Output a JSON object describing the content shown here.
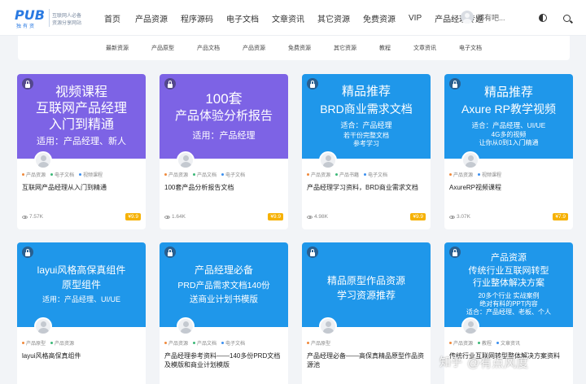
{
  "logo": {
    "mark": "PUB",
    "sub": "独有资",
    "tag1": "互联网人必备",
    "tag2": "资源分享网站"
  },
  "nav": [
    "首页",
    "产品资源",
    "程序源码",
    "电子文档",
    "文章资讯",
    "其它资源",
    "免费资源",
    "VIP",
    "产品经理专题"
  ],
  "user": {
    "name": "都有吧..."
  },
  "categories": [
    "最新资源",
    "产品原型",
    "产品文档",
    "产品资源",
    "免费资源",
    "其它资源",
    "教程",
    "文章资讯",
    "电子文档"
  ],
  "colors": {
    "purple": "#7d63e5",
    "blue": "#1f97ea",
    "price_bg": "#f6b100"
  },
  "cards": [
    {
      "thumb_lines": [
        "视频课程",
        "互联网产品经理",
        "入门到精通",
        "适用：产品经理、新人"
      ],
      "tags": [
        {
          "text": "产品资源",
          "color": "#f08a3c"
        },
        {
          "text": "电子文档",
          "color": "#3cb878"
        },
        {
          "text": "视频课程",
          "color": "#3b8ff0"
        }
      ],
      "title": "互联网产品经理从入门到精通",
      "views": "7.57K",
      "price": "¥9.9"
    },
    {
      "thumb_lines": [
        "100套",
        "产品体验分析报告",
        "适用：产品经理"
      ],
      "tags": [
        {
          "text": "产品资源",
          "color": "#f08a3c"
        },
        {
          "text": "产品文档",
          "color": "#3cb878"
        },
        {
          "text": "电子文档",
          "color": "#3b8ff0"
        }
      ],
      "title": "100套产品分析报告文档",
      "views": "1.64K",
      "price": "¥9.9"
    },
    {
      "thumb_lines": [
        "精品推荐",
        "BRD商业需求文档",
        "适合：产品经理",
        "若干份完整文档",
        "参考学习"
      ],
      "tags": [
        {
          "text": "产品资源",
          "color": "#f08a3c"
        },
        {
          "text": "产品书籍",
          "color": "#3cb878"
        },
        {
          "text": "电子文档",
          "color": "#3b8ff0"
        }
      ],
      "title": "产品经理学习资料，BRD商业需求文档",
      "views": "4.98K",
      "price": "¥9.9"
    },
    {
      "thumb_lines": [
        "精品推荐",
        "Axure RP教学视频",
        "适合：产品经理、UI/UE",
        "4G多的视频",
        "让你从0到1入门精通"
      ],
      "tags": [
        {
          "text": "产品资源",
          "color": "#f08a3c"
        },
        {
          "text": "视频课程",
          "color": "#3b8ff0"
        }
      ],
      "title": "AxureRP视频课程",
      "views": "3.07K",
      "price": "¥7.9"
    },
    {
      "thumb_lines": [
        "layui风格高保真组件",
        "原型组件",
        "适用：产品经理、UI/UE"
      ],
      "tags": [
        {
          "text": "产品原型",
          "color": "#f08a3c"
        },
        {
          "text": "产品资源",
          "color": "#3cb878"
        }
      ],
      "title": "layui风格高保真组件",
      "views": "",
      "price": ""
    },
    {
      "thumb_lines": [
        "产品经理必备",
        "PRD产品需求文档140份",
        "送商业计划书模版"
      ],
      "tags": [
        {
          "text": "产品资源",
          "color": "#f08a3c"
        },
        {
          "text": "产品文档",
          "color": "#3cb878"
        },
        {
          "text": "电子文档",
          "color": "#3b8ff0"
        }
      ],
      "title": "产品经理参考资料——140多份PRD文档及模版和商业计划模版",
      "views": "",
      "price": ""
    },
    {
      "thumb_lines": [
        "精品原型作品资源",
        "学习资源推荐"
      ],
      "tags": [
        {
          "text": "产品原型",
          "color": "#f08a3c"
        }
      ],
      "title": "产品经理必备——高保真精品原型作品资源池",
      "views": "",
      "price": ""
    },
    {
      "thumb_lines": [
        "产品资源",
        "传统行业互联网转型",
        "行业整体解决方案",
        "20多个行业   实战案例",
        "绝对有料的PPT内容",
        "适合：产品经理、老板、个人"
      ],
      "tags": [
        {
          "text": "产品资源",
          "color": "#f08a3c"
        },
        {
          "text": "教程",
          "color": "#3cb878"
        },
        {
          "text": "文章资讯",
          "color": "#3b8ff0"
        }
      ],
      "title": "传统行业互联网转型整体解决方案资料",
      "views": "",
      "price": ""
    }
  ],
  "watermark": {
    "brand": "知乎",
    "handle": "@有点风度"
  }
}
